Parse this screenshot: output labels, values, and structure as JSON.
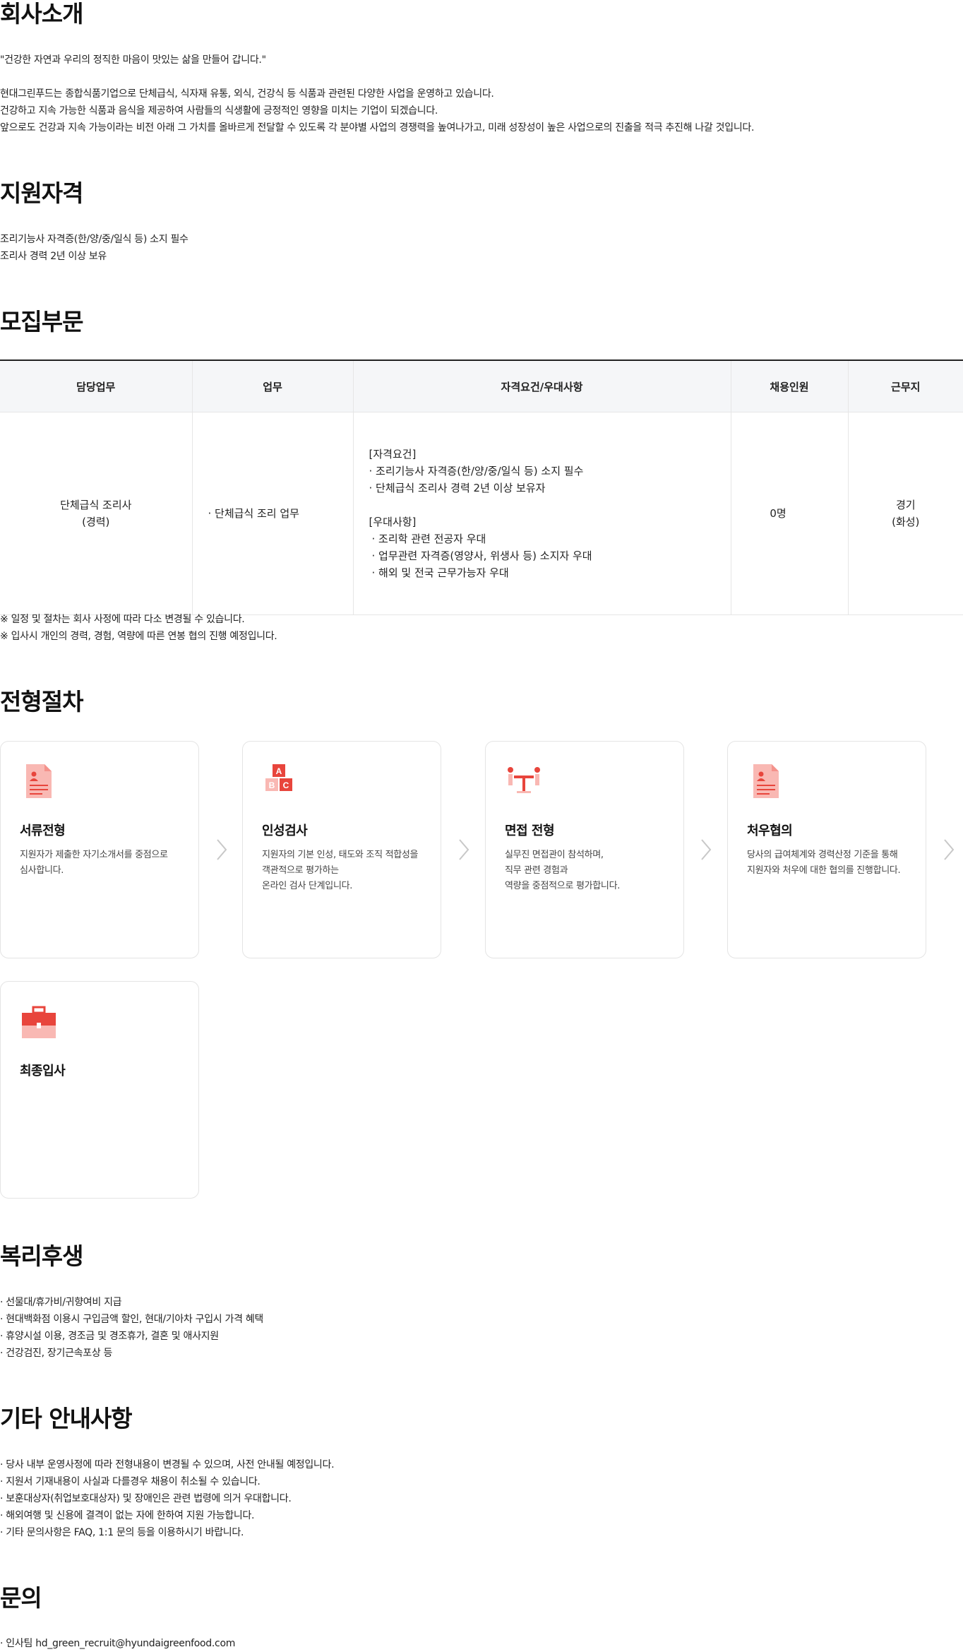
{
  "about": {
    "title": "회사소개",
    "quote": "\"건강한 자연과 우리의 정직한 마음이 맛있는 삶을 만들어 갑니다.\"",
    "lines": [
      "현대그린푸드는 종합식품기업으로 단체급식, 식자재 유통, 외식, 건강식 등 식품과 관련된 다양한 사업을 운영하고 있습니다.",
      "건강하고 지속 가능한 식품과 음식을 제공하여 사람들의 식생활에 긍정적인 영향을 미치는 기업이 되겠습니다.",
      "앞으로도 건강과 지속 가능이라는 비전 아래 그 가치를 올바르게 전달할 수 있도록 각 분야별 사업의 경쟁력을 높여나가고, 미래 성장성이 높은 사업으로의 진출을 적극 추진해 나갈 것입니다."
    ]
  },
  "qualification": {
    "title": "지원자격",
    "lines": [
      "조리기능사 자격증(한/양/중/일식 등) 소지 필수",
      "조리사 경력 2년 이상 보유"
    ]
  },
  "recruit": {
    "title": "모집부문",
    "headers": [
      "담당업무",
      "업무",
      "자격요건/우대사항",
      "채용인원",
      "근무지"
    ],
    "row": {
      "role_line1": "단체급식 조리사",
      "role_line2": "(경력)",
      "task": "· 단체급식 조리 업무",
      "qual_lines": [
        "[자격요건]",
        "· 조리기능사 자격증(한/양/중/일식 등) 소지 필수",
        "· 단체급식 조리사 경력 2년 이상 보유자",
        "",
        "[우대사항]",
        " · 조리학 관련 전공자 우대",
        " · 업무관련 자격증(영양사, 위생사 등) 소지자 우대",
        " · 해외 및 전국 근무가능자 우대"
      ],
      "headcount": "0명",
      "location_line1": "경기",
      "location_line2": "(화성)"
    },
    "notes": [
      "※ 일정 및 절차는 회사 사정에 따라 다소 변경될 수 있습니다.",
      "※ 입사시 개인의 경력, 경험, 역량에 따른 연봉 협의 진행 예정입니다."
    ]
  },
  "process": {
    "title": "전형절차",
    "steps": [
      {
        "title": "서류전형",
        "icon": "document-icon",
        "desc": [
          "지원자가 제출한 자기소개서를 중점으로",
          "심사합니다."
        ]
      },
      {
        "title": "인성검사",
        "icon": "abc-blocks-icon",
        "desc": [
          "지원자의 기본 인성, 태도와 조직 적합성을",
          "객관적으로 평가하는",
          "온라인 검사 단계입니다."
        ]
      },
      {
        "title": "면접 전형",
        "icon": "interview-icon",
        "desc": [
          "실무진 면접관이 참석하며,",
          "직무 관련 경험과",
          "역량을 중점적으로 평가합니다."
        ]
      },
      {
        "title": "처우협의",
        "icon": "document-icon",
        "desc": [
          "당사의 급여체계와 경력산정 기준을 통해",
          "지원자와 처우에 대한 협의를 진행합니다."
        ]
      },
      {
        "title": "최종입사",
        "icon": "briefcase-icon",
        "desc": []
      }
    ],
    "colors": {
      "accent": "#e8453c",
      "light": "#f9b8b3"
    }
  },
  "benefits": {
    "title": "복리후생",
    "lines": [
      "· 선물대/휴가비/귀향여비 지급",
      "· 현대백화점 이용시 구입금액 할인, 현대/기아차 구입시 가격 혜택",
      "· 휴양시설 이용, 경조금 및 경조휴가, 결혼 및 애사지원",
      "· 건강검진, 장기근속포상 등"
    ]
  },
  "etc": {
    "title": "기타 안내사항",
    "lines": [
      "· 당사 내부 운영사정에 따라 전형내용이 변경될 수 있으며, 사전 안내될 예정입니다.",
      "· 지원서 기재내용이 사실과 다를경우 채용이 취소될 수 있습니다.",
      "· 보훈대상자(취업보호대상자) 및 장애인은 관련 법령에 의거 우대합니다.",
      "· 해외여행 및 신용에 결격이 없는 자에 한하여 지원 가능합니다.",
      "· 기타 문의사항은 FAQ, 1:1 문의 등을 이용하시기 바랍니다."
    ]
  },
  "contact": {
    "title": "문의",
    "line": "· 인사팀 hd_green_recruit@hyundaigreenfood.com"
  }
}
